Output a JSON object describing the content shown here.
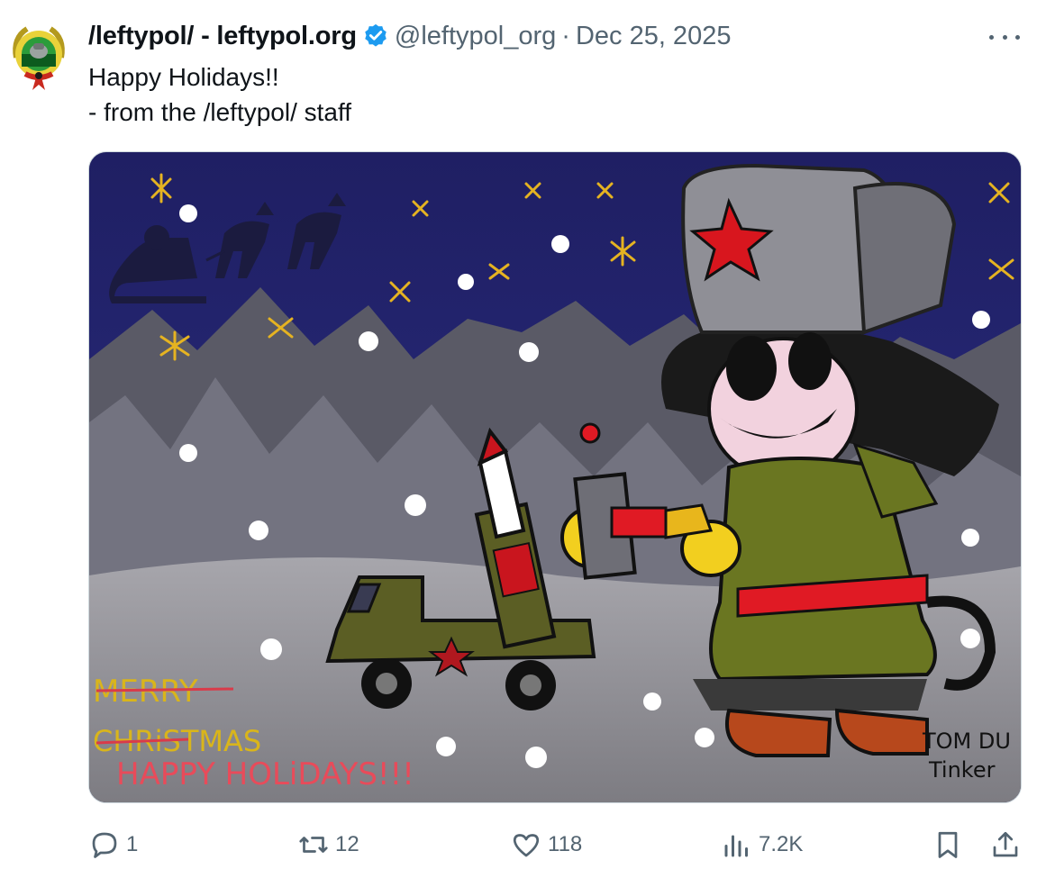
{
  "post": {
    "author_name": "/leftypol/ - leftypol.org",
    "handle": "@leftypol_org",
    "separator": "·",
    "date": "Dec 25, 2025",
    "text_lines": [
      "Happy Holidays!!",
      "- from the /leftypol/ staff"
    ]
  },
  "media": {
    "painted_text": {
      "merry": "MERRY",
      "christmas": "CHRiSTMAS",
      "happy_holidays": "HAPPY HOLiDAYS!!!",
      "signature_line1": "TOM DU",
      "signature_line2": "Tinker"
    }
  },
  "actions": {
    "replies": "1",
    "reposts": "12",
    "likes": "118",
    "views": "7.2K"
  },
  "icons": {
    "verified": "verified-badge-icon",
    "more": "more-icon",
    "reply": "reply-icon",
    "repost": "repost-icon",
    "like": "heart-icon",
    "views": "views-icon",
    "bookmark": "bookmark-icon",
    "share": "share-icon"
  },
  "colors": {
    "verified": "#1d9bf0",
    "muted_text": "#536471",
    "text": "#0f1419"
  }
}
